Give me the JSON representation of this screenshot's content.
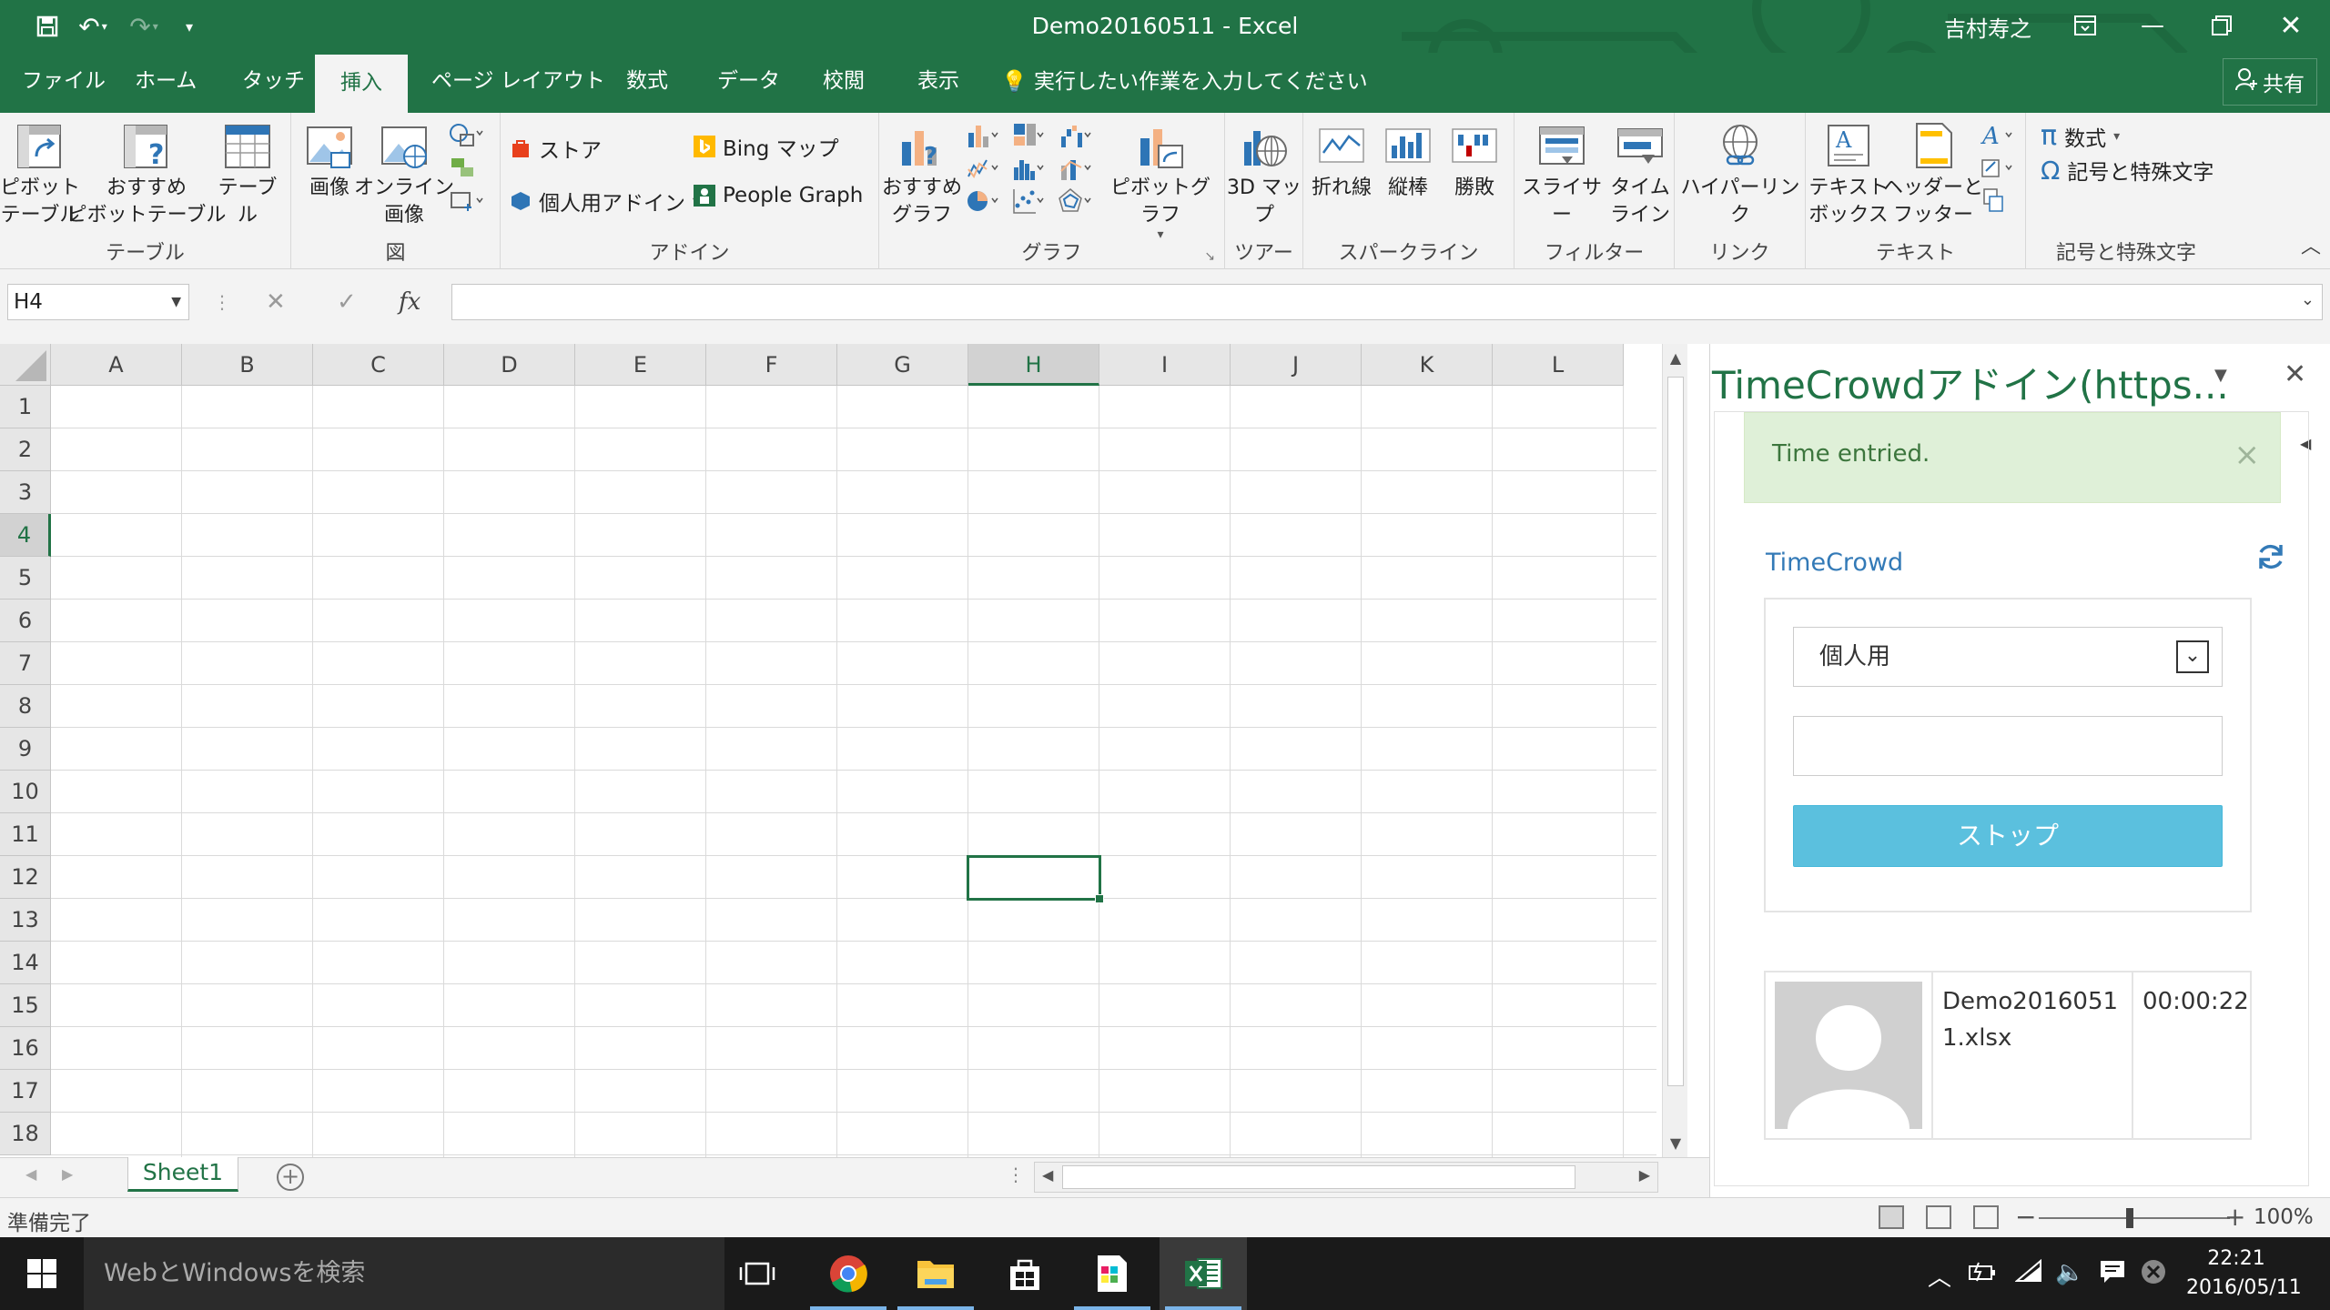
{
  "window": {
    "title": "Demo20160511 - Excel",
    "user": "吉村寿之"
  },
  "tabs": [
    {
      "label": "ファイル"
    },
    {
      "label": "ホーム"
    },
    {
      "label": "タッチ"
    },
    {
      "label": "挿入"
    },
    {
      "label": "ページ レイアウト"
    },
    {
      "label": "数式"
    },
    {
      "label": "データ"
    },
    {
      "label": "校閲"
    },
    {
      "label": "表示"
    }
  ],
  "active_tab": "挿入",
  "tell_me": "実行したい作業を入力してください",
  "share": "共有",
  "ribbon": {
    "table": {
      "label": "テーブル",
      "pivot": "ピボット\nテーブル",
      "recommended_pivot": "おすすめ\nピボットテーブル",
      "table": "テーブル"
    },
    "illustrations": {
      "label": "図",
      "picture": "画像",
      "online_picture": "オンライン\n画像"
    },
    "addins": {
      "label": "アドイン",
      "store": "ストア",
      "bing": "Bing マップ",
      "my_addins": "個人用アドイン",
      "people_graph": "People Graph"
    },
    "charts": {
      "label": "グラフ",
      "recommended": "おすすめ\nグラフ",
      "pivot_chart": "ピボットグラフ"
    },
    "tours": {
      "label": "ツアー",
      "map3d": "3D マッ\nプ"
    },
    "sparklines": {
      "label": "スパークライン",
      "line": "折れ線",
      "column": "縦棒",
      "win_loss": "勝敗"
    },
    "filters": {
      "label": "フィルター",
      "slicer": "スライサー",
      "timeline": "タイム\nライン"
    },
    "links": {
      "label": "リンク",
      "hyperlink": "ハイパーリンク"
    },
    "text": {
      "label": "テキスト",
      "textbox": "テキスト\nボックス",
      "header_footer": "ヘッダーと\nフッター"
    },
    "symbols": {
      "label": "記号と特殊文字",
      "equation": "数式",
      "symbol": "記号と特殊文字"
    }
  },
  "formula_bar": {
    "name_box": "H4",
    "fx": "fx",
    "value": ""
  },
  "sheet": {
    "columns": [
      "A",
      "B",
      "C",
      "D",
      "E",
      "F",
      "G",
      "H",
      "I",
      "J",
      "K",
      "L"
    ],
    "rows": [
      "1",
      "2",
      "3",
      "4",
      "5",
      "6",
      "7",
      "8",
      "9",
      "10",
      "11",
      "12",
      "13",
      "14",
      "15",
      "16",
      "17",
      "18"
    ],
    "selected_cell": "H4",
    "tab": "Sheet1"
  },
  "status": {
    "text": "準備完了",
    "zoom": "100%"
  },
  "task_pane": {
    "title": "TimeCrowdアドイン(https...",
    "alert": "Time entried.",
    "brand": "TimeCrowd",
    "team_select": "個人用",
    "task_input": "",
    "stop_button": "ストップ",
    "entry": {
      "file": "Demo20160511.xlsx",
      "elapsed": "00:00:22"
    }
  },
  "taskbar": {
    "search_placeholder": "WebとWindowsを検索",
    "time": "22:21",
    "date": "2016/05/11"
  },
  "colors": {
    "excel_green": "#217346",
    "alert_bg": "#dff0d8",
    "alert_text": "#3c763d",
    "link_blue": "#337ab7",
    "button_info": "#5bc0de"
  }
}
